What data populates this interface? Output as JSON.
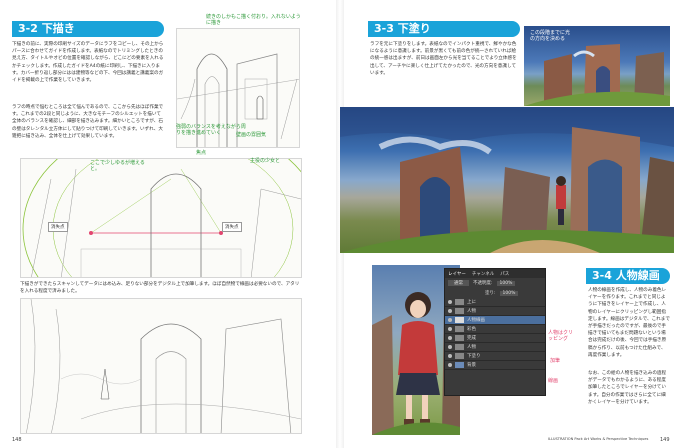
{
  "left_page": {
    "section_3_2": {
      "heading": "3-2 下描き",
      "body": "下描きの前に、実際の印刷サイズのデータにラフをコピーし、その上からパースに合わせてガイドを作成します。表紙なのでトリミングしたときの見え方、タイトルやオビの位置を確認しながら、どこにどの要素を入れるかチェックします。作成したガイドをA4の紙に印刷し、下描きに入ります。カバー折り返し部分にはは建物等などの下、今回は講義と講義案のガイドを掲載の上で作業をしていきます。",
      "body2": "ラフの時点で悩むところは全て悩んであるので、ここから先はほぼ作業です。これまでの2段と同じように、大きなモチーフのシルエットを描いて全体のバランスを確認し、細部を描き込みます。細かいところですが、石の壁はタレンタル立方体にして貼りつけて印刷していきます。いずれ、大雑把に描き込み、全体を仕上げて効果しています。",
      "caption": "下描きができたらスキャンしてデータにはめ込み、足りない部分をデジタル上で加筆します。ほぼ自然物で線画は必要ないので、アタリを入れる程度で済みました。"
    },
    "annotations": {
      "top_sketch_note": "続きのしかもこ描く付おり。入れないように描き",
      "middle_note_left": "ここで少しゆるが増えると。",
      "middle_note_right": "主役の少女と",
      "vp_left": "消失点",
      "vp_right": "消失点",
      "green_note": "強弱のバランスを考えながら周りを描き進めていく",
      "green_note_2": "壁画の雰囲気",
      "small_label": "焦点"
    },
    "folio": "148"
  },
  "right_page": {
    "section_3_3": {
      "heading": "3-3 下塗り",
      "body": "ラフを元に下塗りをします。表紙なのでインパクト重視で、鮮やかな色になるように意識します。前景が黒くても前の色が統一されていれば絵の統一感は出ますが、前日は画面左から光を当てることでより立体感を出して、アーチやに楽しく仕上げてたかったので、光の方向を意識しています。",
      "small_note": "この段階までに光の方向を決める"
    },
    "section_3_4": {
      "heading": "3-4 人物線画",
      "body": "人物の線画を作成し、人物のみ着色レイヤーを作ります。これまでと同じように下描きをレイヤー上で作成し、人物のレイヤーにクリッピングし範囲指定します。線画はデジタルで、これまでが手描きだったのですが、最後ので手描きで描いてもまだ問題ないという場合は完成だけの後、今回では手描き原稿から作り、以前もつけた仕組みで、再度作業します。",
      "body2": "なお、この絵の人物を描き込みの過程がデータでもわかるように、ある程度加筆したところでレイヤーを分けています。自分の作業ではさらに全てに細かくレイヤーを分けています。"
    },
    "layers_panel": {
      "tabs": [
        "レイヤー",
        "チャンネル",
        "パス"
      ],
      "blend_mode": "通常",
      "opacity_label": "不透明度:",
      "opacity_value": "100%",
      "fill_label": "塗り:",
      "fill_value": "100%",
      "layers": [
        {
          "name": "上に",
          "selected": false
        },
        {
          "name": "人物",
          "selected": false
        },
        {
          "name": "人物線画",
          "selected": true
        },
        {
          "name": "彩色",
          "selected": false
        },
        {
          "name": "完成",
          "selected": false
        },
        {
          "name": "人物",
          "selected": false
        },
        {
          "name": "下塗り",
          "selected": false
        },
        {
          "name": "背景",
          "selected": false
        }
      ],
      "pink_notes": [
        "人物はクリッピング",
        "加筆",
        "線画"
      ]
    },
    "footer_title": "ILLUSTRATION Pack Art Works & Perspective Techniques",
    "folio": "149"
  },
  "colors": {
    "heading": "#1aa3d9",
    "green_note": "#2e9a3a",
    "pink_note": "#e2466f"
  }
}
